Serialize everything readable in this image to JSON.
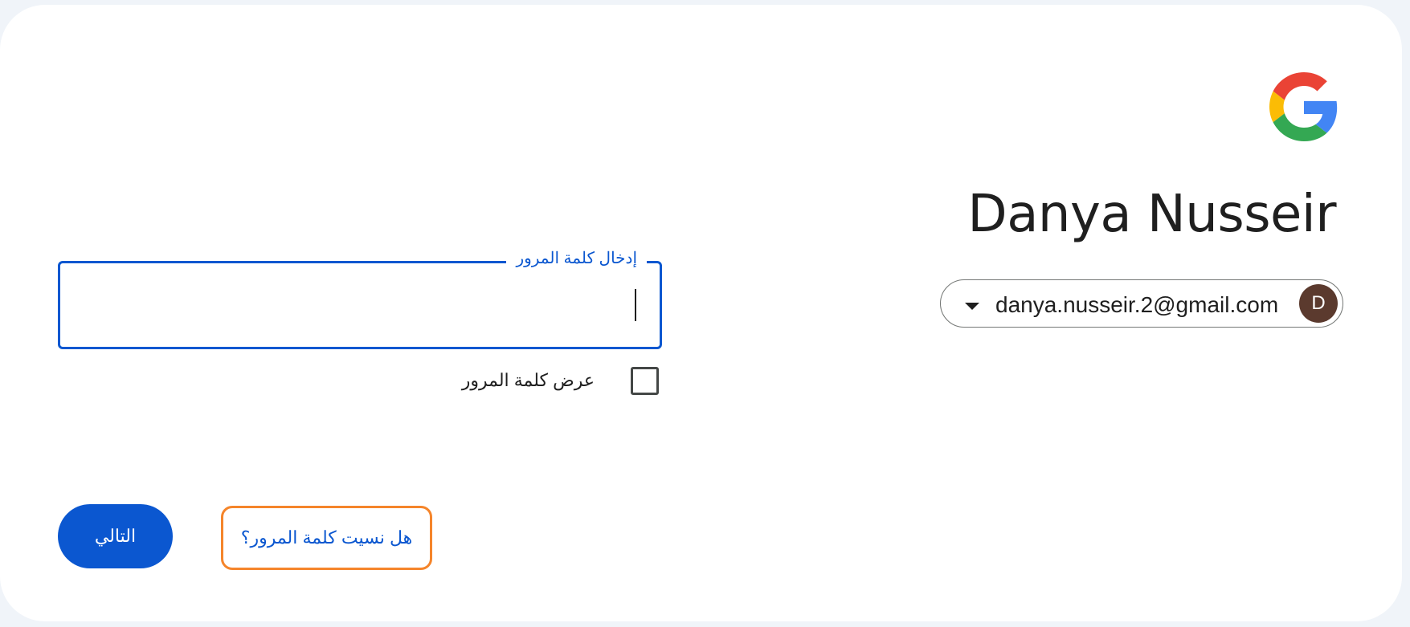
{
  "account": {
    "display_name": "Danya Nusseir",
    "email": "danya.nusseir.2@gmail.com",
    "avatar_initial": "D",
    "avatar_color": "#5b3a2e"
  },
  "logo": {
    "icon": "google-g-logo-icon"
  },
  "password": {
    "label": "إدخال كلمة المرور",
    "value": ""
  },
  "show_password": {
    "label": "عرض كلمة المرور",
    "checked": false
  },
  "actions": {
    "next_label": "التالي",
    "forgot_label": "هل نسيت كلمة المرور؟"
  },
  "colors": {
    "accent": "#0b57d0",
    "focus_ring": "#f5852b",
    "background": "#f0f4f9"
  }
}
